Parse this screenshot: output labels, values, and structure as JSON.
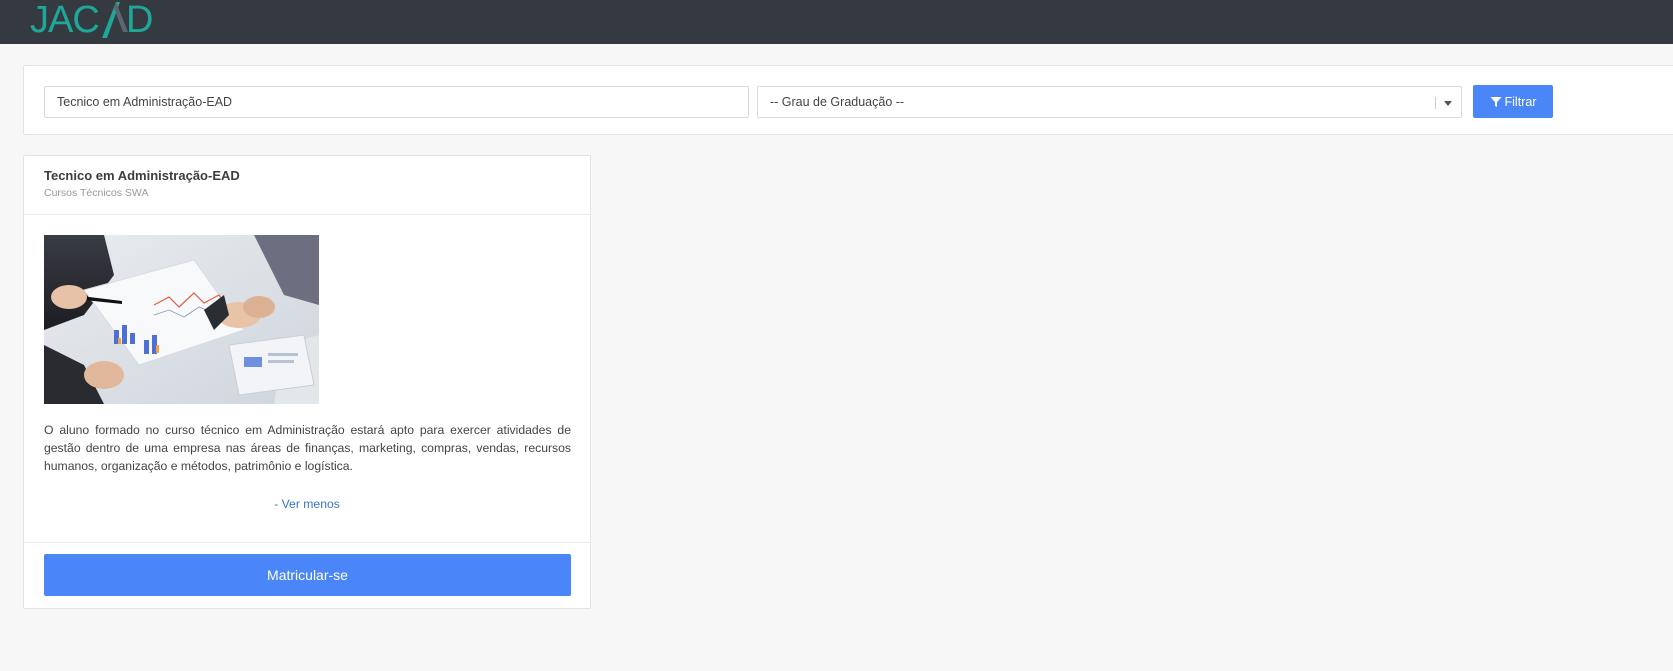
{
  "header": {
    "logo_text": "JACAD",
    "colors": {
      "background": "#343a40",
      "logo_primary": "#1fa89a",
      "logo_accent": "#5b6670"
    }
  },
  "filters": {
    "search_value": "Tecnico em Administração-EAD",
    "degree_select": {
      "selected": "-- Grau de Graduação --"
    },
    "filter_button_label": "Filtrar",
    "filter_icon": "filter-icon"
  },
  "course": {
    "title": "Tecnico em Administração-EAD",
    "subtitle": "Cursos Técnicos SWA",
    "image": "business-meeting-photo",
    "description": "O aluno formado no curso técnico em Administração estará apto para exercer atividades de gestão dentro de uma empresa nas áreas de finanças, marketing, compras, vendas, recursos humanos, organização e métodos, patrimônio e logística.",
    "toggle_label": "- Ver menos",
    "enroll_label": "Matricular-se"
  },
  "colors": {
    "accent": "#4a86f7",
    "link": "#3a73c9",
    "page_background": "#f7f7f7"
  }
}
